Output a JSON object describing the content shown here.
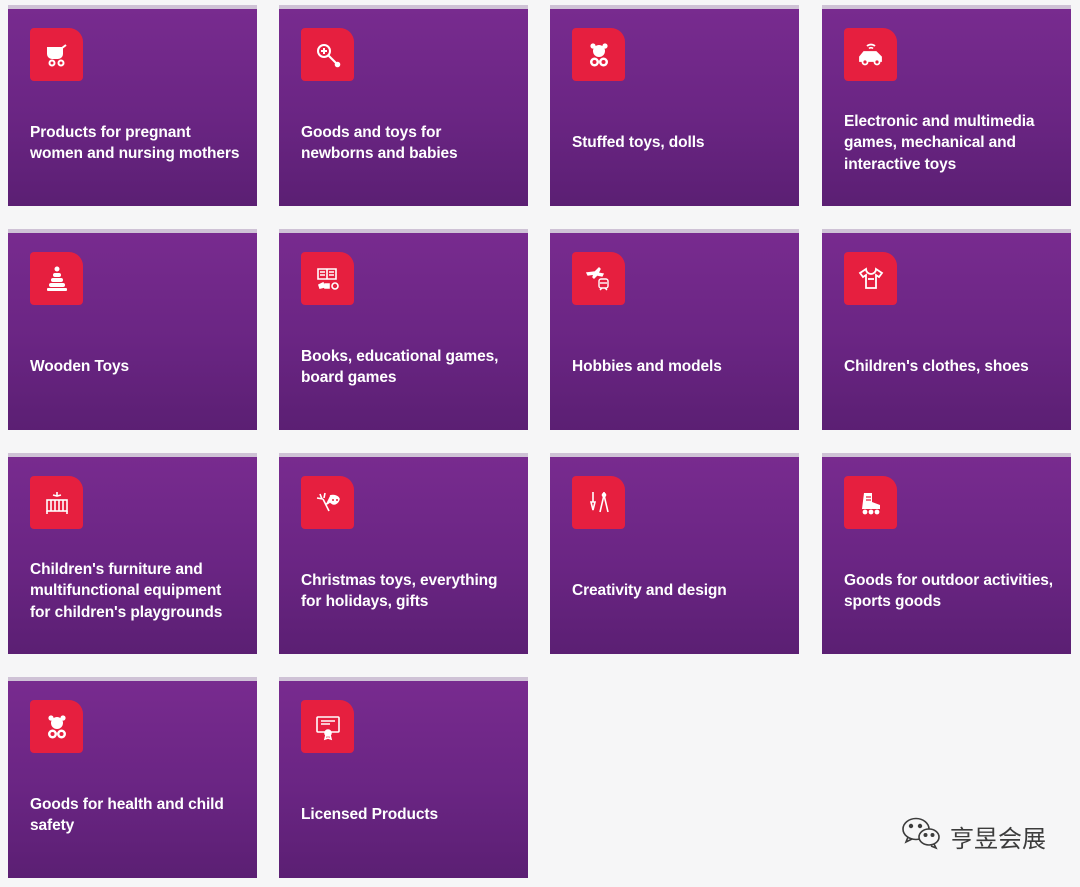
{
  "categories": [
    {
      "label": "Products for pregnant women and nursing mothers",
      "icon": "stroller-icon"
    },
    {
      "label": "Goods and toys for newborns and babies",
      "icon": "rattle-icon"
    },
    {
      "label": "Stuffed toys, dolls",
      "icon": "teddy-bear-icon"
    },
    {
      "label": "Electronic and multimedia games, mechanical and interactive toys",
      "icon": "rc-car-icon"
    },
    {
      "label": "Wooden Toys",
      "icon": "stacking-pyramid-icon"
    },
    {
      "label": "Books, educational games, board games",
      "icon": "book-puzzle-icon"
    },
    {
      "label": "Hobbies and models",
      "icon": "plane-train-icon"
    },
    {
      "label": "Children's clothes, shoes",
      "icon": "tshirt-icon"
    },
    {
      "label": "Children's furniture and multifunctional equipment for children's playgrounds",
      "icon": "crib-icon"
    },
    {
      "label": "Christmas toys, everything for holidays, gifts",
      "icon": "party-mask-icon"
    },
    {
      "label": "Creativity and design",
      "icon": "brush-compass-icon"
    },
    {
      "label": "Goods for outdoor activities, sports goods",
      "icon": "roller-skate-icon"
    },
    {
      "label": "Goods for health and child safety",
      "icon": "bear-shield-icon"
    },
    {
      "label": "Licensed Products",
      "icon": "certificate-icon"
    }
  ],
  "watermark": {
    "text": "亨昱会展",
    "icon": "wechat-icon"
  },
  "colors": {
    "card": "#6a2583",
    "icon_bg": "#e61f3f",
    "page_bg": "#f6f6f7"
  }
}
